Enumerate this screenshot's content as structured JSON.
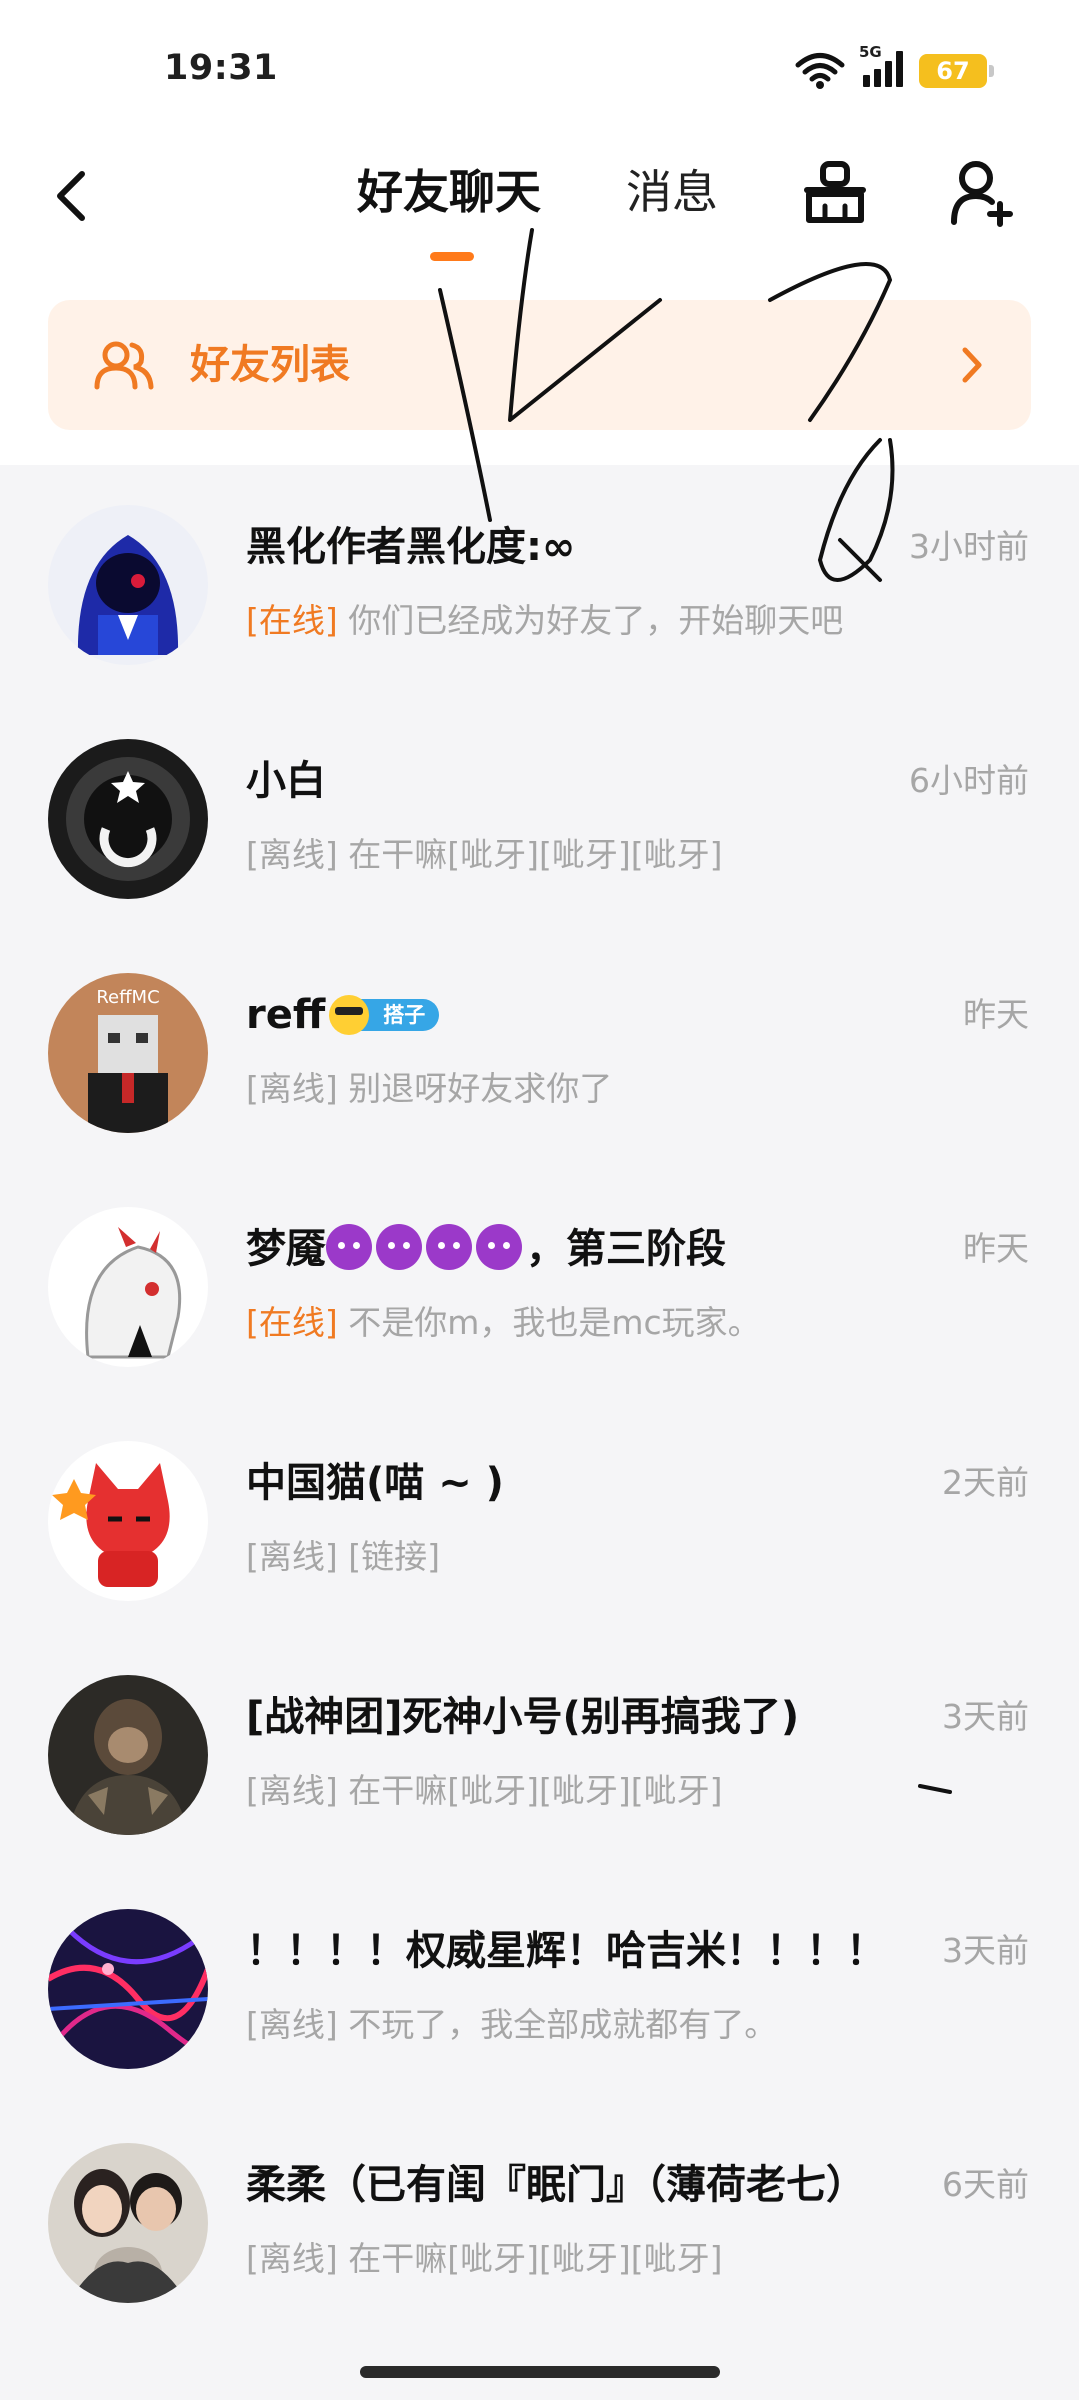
{
  "status_bar": {
    "time": "19:31",
    "network": "5G",
    "battery": "67"
  },
  "header": {
    "tabs": [
      {
        "label": "好友聊天",
        "active": true
      },
      {
        "label": "消息",
        "active": false
      }
    ],
    "accent": "#ff7a1a"
  },
  "banner": {
    "label": "好友列表",
    "background": "#fff2e8",
    "color": "#f07a22"
  },
  "chats": [
    {
      "name": "黑化作者黑化度:∞",
      "time": "3小时前",
      "status": "[在线]",
      "online": true,
      "preview": "你们已经成为好友了，开始聊天吧",
      "avatar": "hooded-blue-figure"
    },
    {
      "name": "小白",
      "time": "6小时前",
      "status": "[离线]",
      "online": false,
      "preview": "在干嘛[呲牙][呲牙][呲牙]",
      "avatar": "dark-star-circle"
    },
    {
      "name": "reff",
      "time": "昨天",
      "status": "[离线]",
      "online": false,
      "preview": "别退呀好友求你了",
      "badge": "搭子",
      "avatar_text": "ReffMC"
    },
    {
      "name_prefix": "梦魇",
      "name_suffix": "，第三阶段",
      "devil_count": 4,
      "time": "昨天",
      "status": "[在线]",
      "online": true,
      "preview": "不是你m，我也是mc玩家。",
      "avatar": "white-demon-anime"
    },
    {
      "name": "中国猫(喵 ~ )",
      "time": "2天前",
      "status": "[离线]",
      "online": false,
      "preview": "[链接]",
      "avatar": "red-cat"
    },
    {
      "name": "[战神团]死神小号(别再搞我了)",
      "time": "3天前",
      "status": "[离线]",
      "online": false,
      "preview": "在干嘛[呲牙][呲牙][呲牙]",
      "avatar": "monkey-warrior"
    },
    {
      "name": "！！！！权威星辉！哈吉米！！！！",
      "time": "3天前",
      "status": "[离线]",
      "online": false,
      "preview": "不玩了，我全部成就都有了。",
      "avatar": "red-neon-lines"
    },
    {
      "name": "柔柔（已有闺『眠门』（薄荷老七）",
      "time": "6天前",
      "status": "[离线]",
      "online": false,
      "preview": "在干嘛[呲牙][呲牙][呲牙]",
      "avatar": "couple-photo"
    }
  ]
}
